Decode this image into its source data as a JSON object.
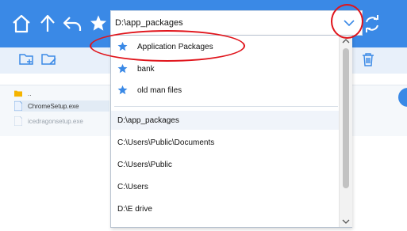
{
  "toolbar": {
    "home_icon": "home-icon",
    "up_icon": "arrow-up-icon",
    "back_icon": "undo-arrow-icon",
    "favorites_icon": "star-icon",
    "refresh_icon": "refresh-icon",
    "path_value": "D:\\app_packages",
    "dropdown_icon": "chevron-down-icon"
  },
  "subtoolbar": {
    "new_folder_icon": "new-folder-icon",
    "edit_folder_icon": "edit-folder-icon",
    "delete_icon": "trash-icon"
  },
  "files": [
    {
      "name": "..",
      "type": "folder"
    },
    {
      "name": "ChromeSetup.exe",
      "type": "file"
    },
    {
      "name": "icedragonsetup.exe",
      "type": "file"
    }
  ],
  "dropdown": {
    "favorites": [
      {
        "label": "Application Packages"
      },
      {
        "label": "bank"
      },
      {
        "label": "old man files"
      }
    ],
    "history": [
      {
        "label": "D:\\app_packages"
      },
      {
        "label": "C:\\Users\\Public\\Documents"
      },
      {
        "label": "C:\\Users\\Public"
      },
      {
        "label": "C:\\Users"
      },
      {
        "label": "D:\\E drive"
      }
    ]
  },
  "colors": {
    "accent": "#3a89e6",
    "favorite_star": "#3a89e6",
    "annotation": "#e0141b"
  }
}
